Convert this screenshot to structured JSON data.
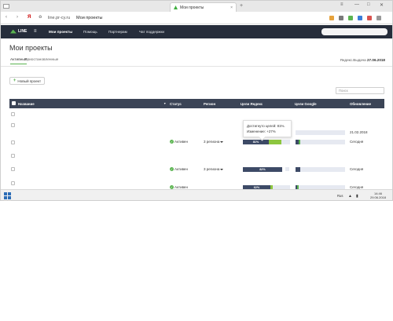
{
  "browser": {
    "tab_title": "Мои проекты",
    "tab_close": "×",
    "new_tab": "+",
    "url": "line.pr-cy.ru",
    "page_title": "Мои проекты",
    "back": "‹",
    "fwd": "›",
    "yandex_logo": "Я",
    "lock": "♻",
    "min": "—",
    "max": "□",
    "close": "✕",
    "menu": "≡"
  },
  "site": {
    "logo": "LINE",
    "menu_icon": "≡",
    "nav": [
      "Мои проекты",
      "Помощь",
      "Партнерам",
      "Чат поддержки"
    ]
  },
  "page": {
    "title": "Мои проекты",
    "tabs": [
      "Активные",
      "Приостановленные"
    ],
    "yandex_label": "Яндекс.Выдача",
    "yandex_date": "27.06.2018",
    "new_project": "Новый проект",
    "new_icon": "+",
    "search_placeholder": "Поиск"
  },
  "table": {
    "columns": [
      "Название",
      "Статус",
      "Регион",
      "Цели Яндекс",
      "Цели Google",
      "Обновление"
    ],
    "sort_icon": "▼",
    "rows": [
      {
        "status": "",
        "region": "",
        "yandex": "",
        "google": "",
        "updated": "21.02.2018"
      },
      {
        "status": "Активен",
        "region": "3 региона",
        "yandex": "81%",
        "google": "",
        "updated": "Сегодня"
      },
      {
        "status": "Активен",
        "region": "3 региона",
        "yandex": "82%",
        "google": "",
        "updated": "Сегодня"
      },
      {
        "status": "Активен",
        "region": "",
        "yandex": "62%",
        "google": "",
        "updated": "Сегодня"
      }
    ],
    "yandex_values": [
      0,
      0.81,
      0.82,
      0.62
    ]
  },
  "tooltip": {
    "line1": "Достигнуто целей: 81%.",
    "line2": "Изменение: +27%"
  },
  "taskbar": {
    "lang": "Rus",
    "time": "14:46",
    "date": "29.06.2018"
  },
  "colors": {
    "nav_bg": "#262d3b",
    "thead_bg": "#3b4456",
    "accent_green": "#5bb450",
    "bar_dark": "#3d4a66",
    "bar_light": "#8dc63f"
  }
}
